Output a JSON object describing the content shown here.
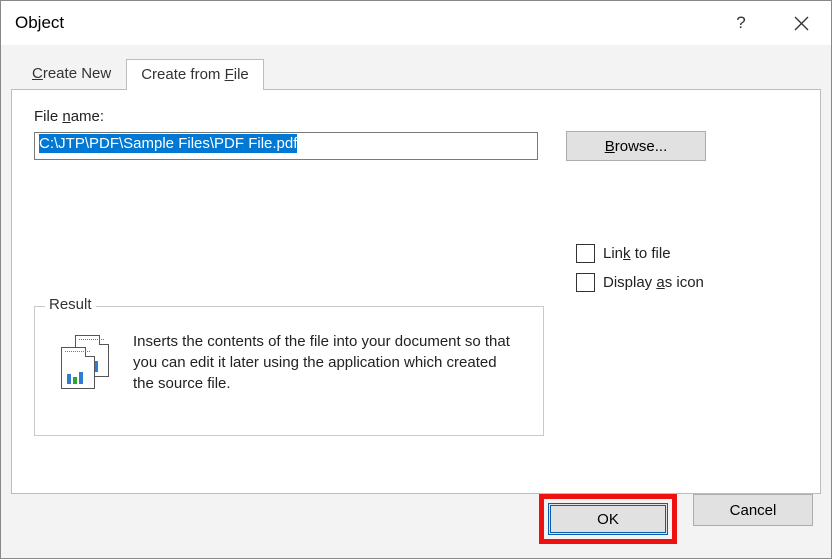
{
  "dialog": {
    "title": "Object",
    "help_tooltip": "?",
    "close_tooltip": "Close"
  },
  "tabs": {
    "create_new": "Create New",
    "create_new_ul": "C",
    "create_from_file": "Create from File",
    "create_from_file_ul_pre": "Create from ",
    "create_from_file_ul_char": "F",
    "create_from_file_ul_post": "ile"
  },
  "file": {
    "label_pre": "File ",
    "label_ul": "n",
    "label_post": "ame:",
    "path": "C:\\JTP\\PDF\\Sample Files\\PDF File.pdf",
    "browse_ul": "B",
    "browse_rest": "rowse..."
  },
  "options": {
    "link_pre": "Lin",
    "link_ul": "k",
    "link_post": " to file",
    "icon_pre": "Display ",
    "icon_ul": "a",
    "icon_post": "s icon"
  },
  "result": {
    "legend": "Result",
    "text": "Inserts the contents of the file into your document so that you can edit it later using the application which created the source file."
  },
  "buttons": {
    "ok": "OK",
    "cancel": "Cancel"
  }
}
